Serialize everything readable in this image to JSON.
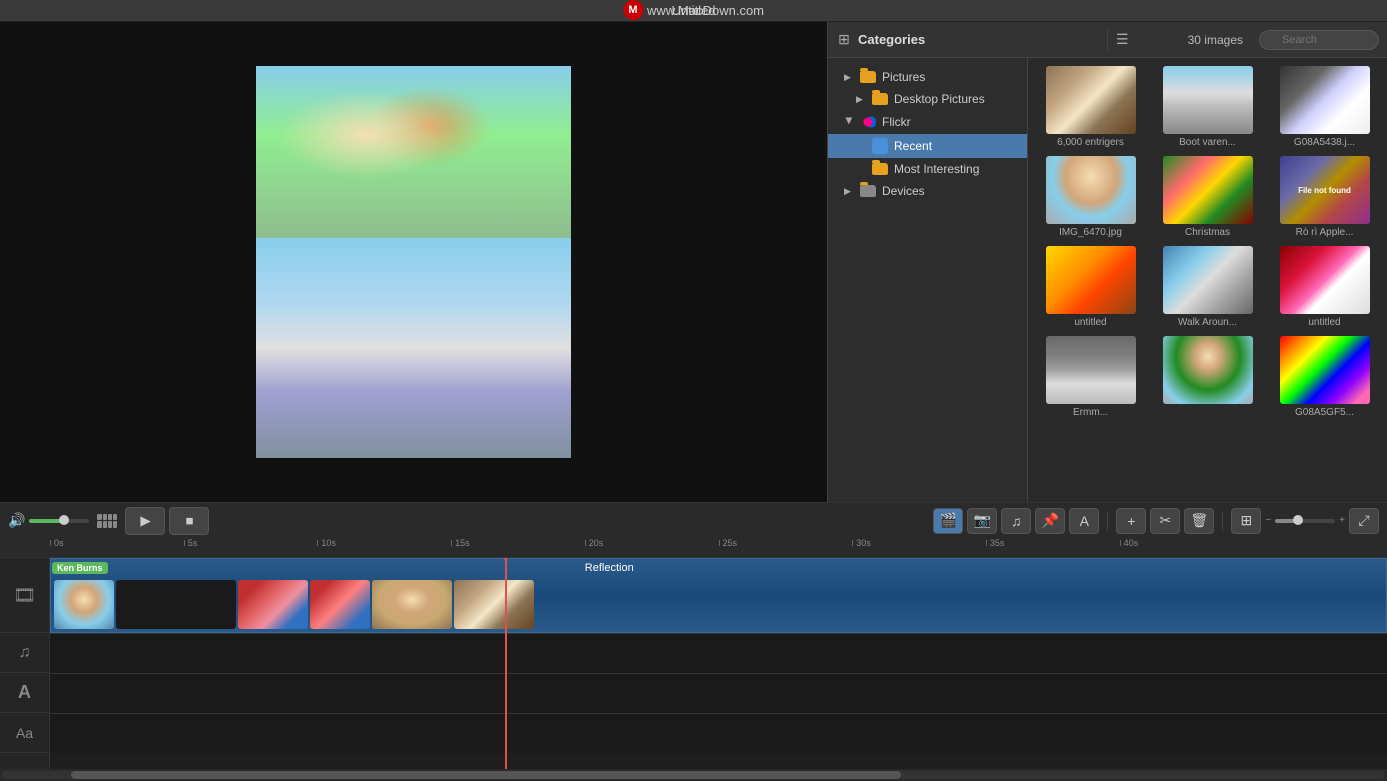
{
  "titleBar": {
    "title": "Untitled",
    "watermark": "www.MacDown.com"
  },
  "mediaBrowser": {
    "categoriesLabel": "Categories",
    "imagesCount": "30 images",
    "search": {
      "placeholder": "Search",
      "value": ""
    },
    "sidebar": {
      "items": [
        {
          "id": "pictures",
          "label": "Pictures",
          "type": "folder",
          "indent": 0,
          "expanded": false
        },
        {
          "id": "desktop-pictures",
          "label": "Desktop Pictures",
          "type": "folder",
          "indent": 1,
          "expanded": false
        },
        {
          "id": "flickr",
          "label": "Flickr",
          "type": "flickr",
          "indent": 0,
          "expanded": true
        },
        {
          "id": "recent",
          "label": "Recent",
          "type": "recent",
          "indent": 1,
          "selected": true
        },
        {
          "id": "most-interesting",
          "label": "Most Interesting",
          "type": "folder",
          "indent": 1,
          "selected": false
        },
        {
          "id": "devices",
          "label": "Devices",
          "type": "folder",
          "indent": 0,
          "expanded": false
        }
      ]
    },
    "images": [
      {
        "id": "img1",
        "label": "6,000 entrigers",
        "type": "cat"
      },
      {
        "id": "img2",
        "label": "Boot varen...",
        "type": "boot"
      },
      {
        "id": "img3",
        "label": "G08A5438.j...",
        "type": "g08"
      },
      {
        "id": "img4",
        "label": "IMG_6470.jpg",
        "type": "person"
      },
      {
        "id": "img5",
        "label": "Christmas",
        "type": "christmas"
      },
      {
        "id": "img6",
        "label": "Rò rì Apple...",
        "type": "filenotfound"
      },
      {
        "id": "img7",
        "label": "untitled",
        "type": "yellow"
      },
      {
        "id": "img8",
        "label": "Walk Aroun...",
        "type": "street"
      },
      {
        "id": "img9",
        "label": "untitled",
        "type": "untitled2"
      },
      {
        "id": "img10",
        "label": "Ermm...",
        "type": "door"
      },
      {
        "id": "img11",
        "label": "",
        "type": "group"
      },
      {
        "id": "img12",
        "label": "G08A5GF5...",
        "type": "colorful"
      }
    ]
  },
  "playback": {
    "playBtn": "▶",
    "stopBtn": "■",
    "volumeLevel": 60
  },
  "timeline": {
    "rulerMarks": [
      "0s",
      "5s",
      "10s",
      "15s",
      "20s",
      "25s",
      "30s",
      "35s",
      "40s"
    ],
    "kenBurnsLabel": "Ken Burns",
    "reflectionLabel": "Reflection",
    "playheadPosition": "34%"
  },
  "toolbar": {
    "mediaBtn": "🎬",
    "photoBtn": "📷",
    "musicBtn": "♫",
    "mapsBtn": "📌",
    "textBtn": "A",
    "addBtn": "+",
    "cropBtn": "✂",
    "deleteBtn": "🗑",
    "layoutBtn": "⊞",
    "zoomLabel": "zoom"
  }
}
